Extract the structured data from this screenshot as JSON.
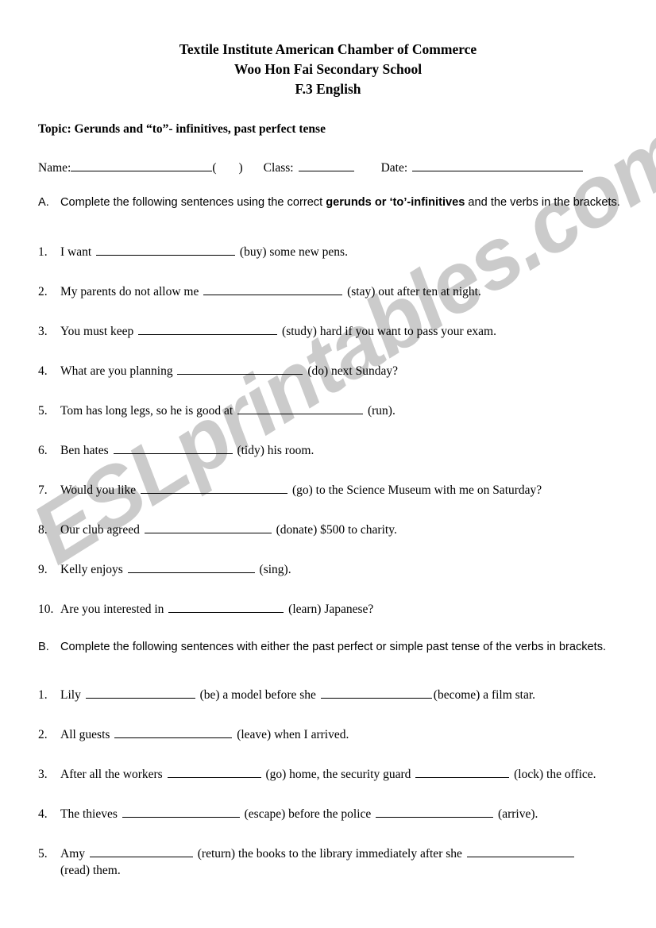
{
  "document": {
    "header": {
      "line1": "Textile Institute American Chamber of Commerce",
      "line2": "Woo Hon Fai Secondary School",
      "line3": "F.3 English"
    },
    "topic": "Topic: Gerunds and “to”- infinitives, past perfect tense",
    "info_row": {
      "name_label": "Name:",
      "open_paren": "(",
      "close_paren": ")",
      "class_label": "Class:",
      "date_label": "Date:",
      "name_value": "",
      "class_value": "",
      "date_value": ""
    },
    "watermark": {
      "text": "ESLprintables.com",
      "color": "#cbcbcb"
    }
  },
  "sections": [
    {
      "marker": "A.",
      "instruction_before_bold": "Complete the following sentences using the correct ",
      "instruction_bold": "gerunds or ‘to’-infinitives",
      "instruction_after_bold": " and the verbs in the brackets.",
      "questions": [
        {
          "num": "1.",
          "before": "I want ",
          "blank1": 175,
          "after": " (buy) some new pens."
        },
        {
          "num": "2.",
          "before": "My parents do not allow me ",
          "blank1": 175,
          "after": " (stay) out after ten at night."
        },
        {
          "num": "3.",
          "before": "You must keep ",
          "blank1": 175,
          "after": " (study) hard if you want to pass your exam."
        },
        {
          "num": "4.",
          "before": "What are you planning ",
          "blank1": 158,
          "after": " (do) next Sunday?"
        },
        {
          "num": "5.",
          "before": "Tom has long legs, so he is good at ",
          "blank1": 158,
          "after": " (run)."
        },
        {
          "num": "6.",
          "before": "Ben hates ",
          "blank1": 150,
          "after": " (tidy) his room."
        },
        {
          "num": "7.",
          "before": "Would you like ",
          "blank1": 185,
          "after": " (go) to the Science Museum with me on Saturday?"
        },
        {
          "num": "8.",
          "before": "Our club agreed ",
          "blank1": 160,
          "after": " (donate) $500 to charity."
        },
        {
          "num": "9.",
          "before": "Kelly enjoys ",
          "blank1": 160,
          "after": " (sing)."
        },
        {
          "num": "10.",
          "before": "Are you interested in ",
          "blank1": 145,
          "after": " (learn) Japanese?"
        }
      ]
    },
    {
      "marker": "B.",
      "instruction_before_bold": "Complete the following sentences with either the past perfect or simple past tense of the verbs in brackets.",
      "instruction_bold": "",
      "instruction_after_bold": "",
      "questions": [
        {
          "num": "1.",
          "before": "Lily ",
          "blank1": 138,
          "middle": " (be) a model before she ",
          "blank2": 140,
          "after": "(become) a film star."
        },
        {
          "num": "2.",
          "before": "All guests ",
          "blank1": 148,
          "after": " (leave) when I arrived."
        },
        {
          "num": "3.",
          "before": "After all the workers ",
          "blank1": 118,
          "middle": " (go) home, the security guard ",
          "blank2": 118,
          "after": " (lock) the office."
        },
        {
          "num": "4.",
          "before": "The thieves ",
          "blank1": 148,
          "middle": " (escape) before the police ",
          "blank2": 148,
          "after": " (arrive)."
        },
        {
          "num": "5.",
          "before": "Amy ",
          "blank1": 130,
          "middle": " (return) the books to the library immediately after she ",
          "blank2": 135,
          "after": "",
          "tail": "(read) them."
        }
      ]
    }
  ]
}
